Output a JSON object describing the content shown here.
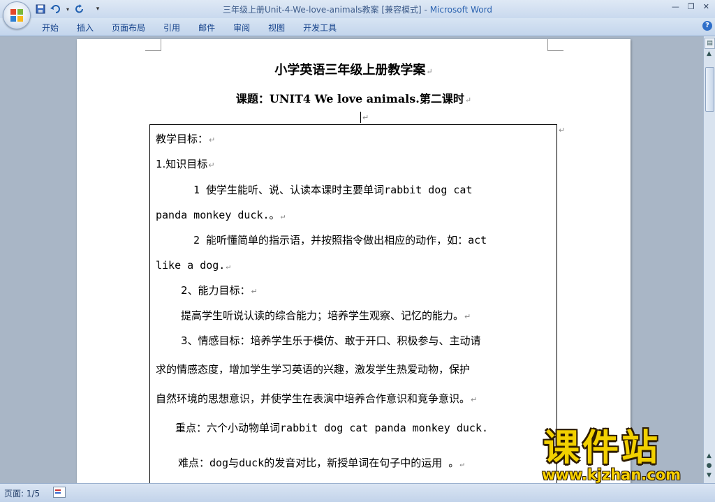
{
  "window": {
    "title": "三年级上册Unit-4-We-love-animals教案 [兼容模式]",
    "title_sep": " - ",
    "app_name": "Microsoft Word"
  },
  "quick_access": {
    "save_icon": "save-icon",
    "undo_icon": "undo-icon",
    "redo_icon": "redo-icon",
    "customize_icon": "customize-qat-icon"
  },
  "ribbon": {
    "tabs": [
      "开始",
      "插入",
      "页面布局",
      "引用",
      "邮件",
      "审阅",
      "视图",
      "开发工具"
    ]
  },
  "document": {
    "title": "小学英语三年级上册教学案",
    "subtitle": "课题：UNIT4 We love animals.第二课时",
    "para_mark": "↵",
    "lines": [
      "教学目标：",
      "1.知识目标",
      "1  使学生能听、说、认读本课时主要单词rabbit  dog  cat",
      "panda  monkey  duck.。",
      "2  能听懂简单的指示语，并按照指令做出相应的动作，如：act",
      "like a dog.",
      "2、能力目标：",
      "提高学生听说认读的综合能力；培养学生观察、记忆的能力。",
      "3、情感目标：培养学生乐于模仿、敢于开口、积极参与、主动请",
      "求的情感态度，增加学生学习英语的兴趣，激发学生热爱动物，保护",
      "自然环境的思想意识，并使学生在表演中培养合作意识和竞争意识。",
      "重点：六个小动物单词rabbit  dog  cat  panda  monkey  duck.",
      "难点：dog与duck的发音对比，新授单词在句子中的运用 。"
    ]
  },
  "statusbar": {
    "page_label": "页面: 1/5"
  },
  "watermark": {
    "title": "课件站",
    "url": "www.kjzhan.com"
  },
  "colors": {
    "ribbon_text": "#15428b",
    "app_name": "#2c63b0",
    "watermark_fill": "#f2d000"
  }
}
